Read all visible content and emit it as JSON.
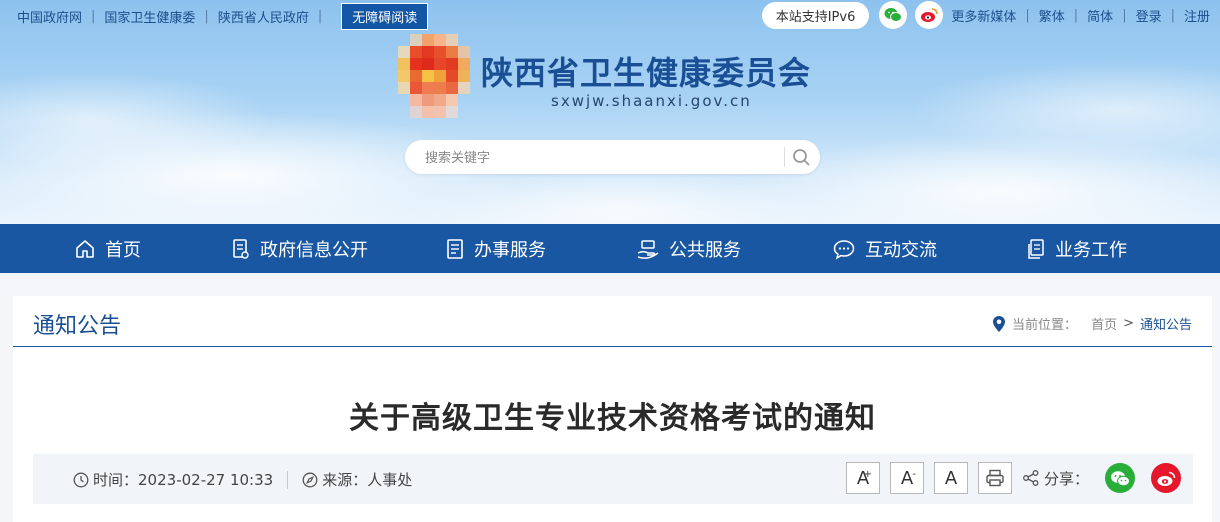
{
  "top_links": {
    "items": [
      "中国政府网",
      "国家卫生健康委",
      "陕西省人民政府"
    ],
    "accessibility": "无障碍阅读"
  },
  "top_right": {
    "ipv6": "本站支持IPv6",
    "links": [
      "更多新媒体",
      "繁体",
      "简体",
      "登录",
      "注册"
    ]
  },
  "site": {
    "title": "陕西省卫生健康委员会",
    "domain": "sxwjw.shaanxi.gov.cn"
  },
  "search": {
    "placeholder": "搜索关键字"
  },
  "nav": {
    "items": [
      {
        "label": "首页",
        "icon": "home-icon"
      },
      {
        "label": "政府信息公开",
        "icon": "document-icon"
      },
      {
        "label": "办事服务",
        "icon": "form-icon"
      },
      {
        "label": "公共服务",
        "icon": "hand-service-icon"
      },
      {
        "label": "互动交流",
        "icon": "chat-icon"
      },
      {
        "label": "业务工作",
        "icon": "files-icon"
      }
    ]
  },
  "section": {
    "title": "通知公告",
    "breadcrumb_label": "当前位置：",
    "breadcrumb": [
      "首页",
      "通知公告"
    ]
  },
  "article": {
    "title": "关于高级卫生专业技术资格考试的通知",
    "time_label": "时间：",
    "time": "2023-02-27 10:33",
    "source_label": "来源：",
    "source": "人事处",
    "font_buttons": [
      "A",
      "A",
      "A"
    ],
    "font_increase_mark": "+",
    "font_decrease_mark": "-",
    "share_label": "分享："
  },
  "colors": {
    "nav_bg": "#1a57a2",
    "title_blue": "#1a4f95",
    "wechat_green": "#2aae3a",
    "weibo_red": "#e6162d"
  }
}
